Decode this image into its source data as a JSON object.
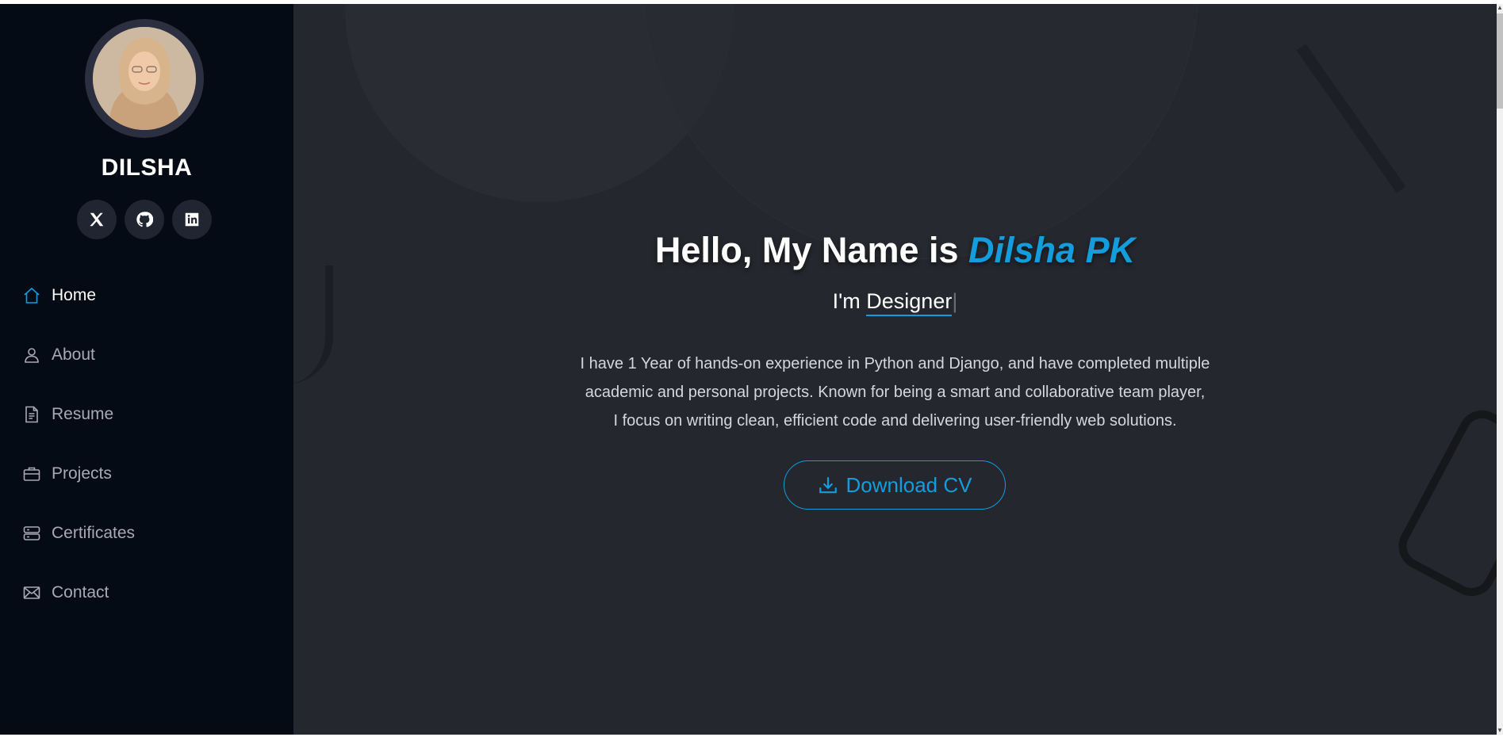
{
  "sidebar": {
    "profile_name": "DILSHA",
    "social_links": [
      {
        "icon": "x-twitter-icon"
      },
      {
        "icon": "github-icon"
      },
      {
        "icon": "linkedin-icon"
      }
    ],
    "nav": [
      {
        "label": "Home",
        "icon": "house-icon",
        "active": true
      },
      {
        "label": "About",
        "icon": "person-icon"
      },
      {
        "label": "Resume",
        "icon": "file-text-icon"
      },
      {
        "label": "Projects",
        "icon": "briefcase-icon"
      },
      {
        "label": "Certificates",
        "icon": "server-icon"
      },
      {
        "label": "Contact",
        "icon": "envelope-icon"
      }
    ]
  },
  "hero": {
    "title_prefix": "Hello, My Name is ",
    "title_name": "Dilsha PK",
    "subtitle_prefix": "I'm ",
    "subtitle_typed": "Designer",
    "description_lines": [
      "I have 1 Year of hands-on experience in Python and Django, and have completed multiple",
      "academic and personal projects. Known for being a smart and collaborative team player,",
      "I focus on writing clean, efficient code and delivering user-friendly web solutions."
    ],
    "cta_label": "Download CV",
    "cta_icon": "download-icon"
  },
  "colors": {
    "accent": "#149ddd",
    "sidebar_bg": "#040b14",
    "content_bg": "#24272d"
  }
}
